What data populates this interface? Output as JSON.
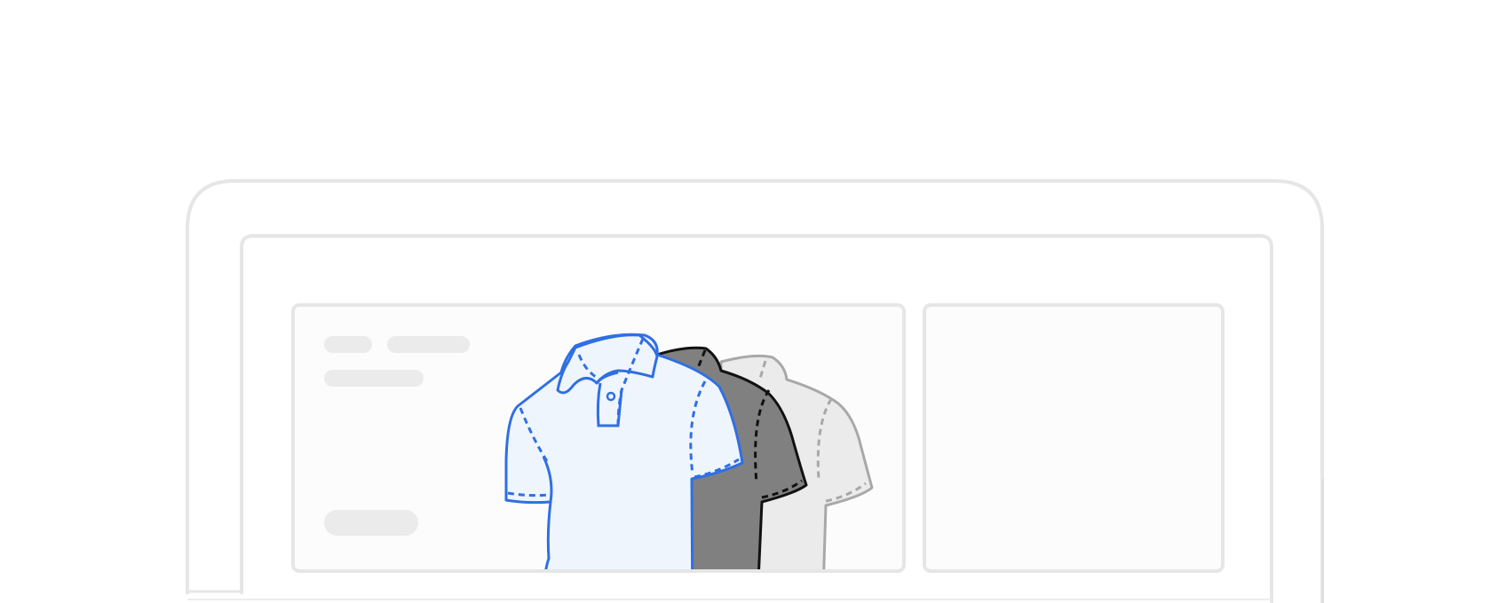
{
  "illustration": {
    "kind": "device-mockup-with-shirts",
    "icons": [
      "laptop-frame-icon",
      "content-card-icon",
      "polo-shirt-icon"
    ],
    "colors": {
      "frame_stroke": "#e6e6e6",
      "card_fill": "#fcfcfc",
      "placeholder_pill": "#ebebeb",
      "accent_blue": "#2f6fe4",
      "shirt_blue_fill": "#eff5fd",
      "shirt_dark_fill": "#808080",
      "shirt_dark_stroke": "#111111",
      "shirt_light_fill": "#ebebeb",
      "shirt_light_stroke": "#a8a8a8"
    },
    "shirts": [
      {
        "id": "shirt-light",
        "style": "light-gray"
      },
      {
        "id": "shirt-dark",
        "style": "dark-gray"
      },
      {
        "id": "shirt-blue",
        "style": "blue-outline"
      }
    ],
    "placeholder_bars": 4,
    "cards": 2
  }
}
